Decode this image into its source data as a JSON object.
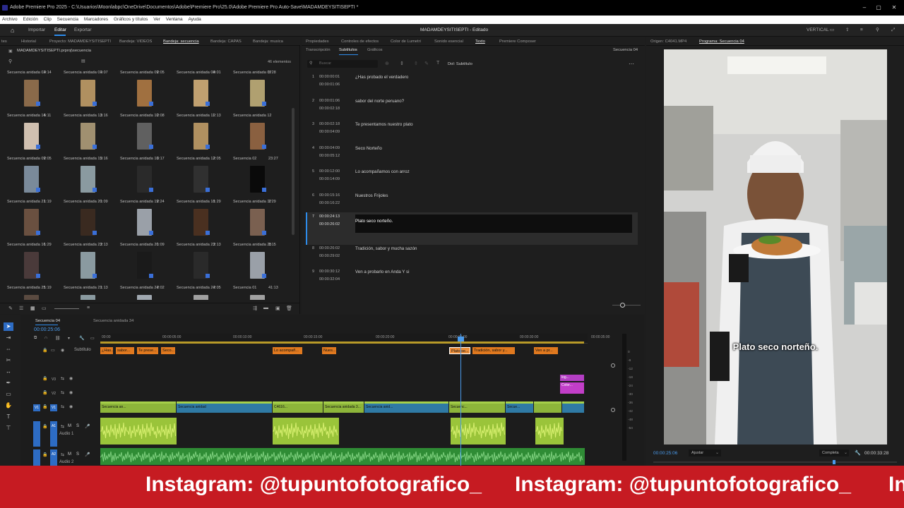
{
  "window": {
    "title": "Adobe Premiere Pro 2025 - C:\\Usuarios\\Moonlabpc\\OneDrive\\Documentos\\Adobe\\Premiere Pro\\25.0\\Adobe Premiere Pro Auto-Save\\MADAMDEYSITISEPTI *",
    "min": "–",
    "max": "▢",
    "close": "✕"
  },
  "menu": [
    "Archivo",
    "Edición",
    "Clip",
    "Secuencia",
    "Marcadores",
    "Gráficos y títulos",
    "Ver",
    "Ventana",
    "Ayuda"
  ],
  "workspace": {
    "home": "⌂",
    "import": "Importar",
    "edit": "Editar",
    "export": "Exportar",
    "project_title": "MADAMDEYSITISEPTI - Editado",
    "mode": "VERTICAL"
  },
  "project_panel": {
    "tabs": [
      "tes",
      "Historial",
      "Proyecto: MADAMDEYSITISEPTI",
      "Bandeja: VIDEOS",
      "Bandeja: secuencia",
      "Bandeja: CAPAS",
      "Bandeja: musica"
    ],
    "path": "MADAMDEYSITISEPTI.prproj\\secuencia",
    "count": "46 elementos",
    "items": [
      {
        "name": "Secuencia anidada 02",
        "dur": "4:14",
        "color": "#8a6a4a"
      },
      {
        "name": "Secuencia anidada 01",
        "dur": "4:07",
        "color": "#b09060"
      },
      {
        "name": "Secuencia anidada 09",
        "dur": "2:05",
        "color": "#a07040"
      },
      {
        "name": "Secuencia anidada 08",
        "dur": "4:01",
        "color": "#c0a070"
      },
      {
        "name": "Secuencia anidada 07",
        "dur": "5:28",
        "color": "#b0a070"
      },
      {
        "name": "Secuencia anidada 14",
        "dur": "5:11",
        "color": "#d0c0b0"
      },
      {
        "name": "Secuencia anidada 13",
        "dur": "3:16",
        "color": "#a09070"
      },
      {
        "name": "Secuencia anidada 10",
        "dur": "2:08",
        "color": "#606060"
      },
      {
        "name": "Secuencia anidada 11",
        "dur": "2:13",
        "color": "#b09060"
      },
      {
        "name": "Secuencia anidada 12",
        "dur": "",
        "color": "#8a6040"
      },
      {
        "name": "Secuencia anidada 09",
        "dur": "2:05",
        "color": "#7a8a9a"
      },
      {
        "name": "Secuencia anidada 15",
        "dur": "3:16",
        "color": "#8a9aa0"
      },
      {
        "name": "Secuencia anidada 16",
        "dur": "3:17",
        "color": "#2a2a2a"
      },
      {
        "name": "Secuencia anidada 12",
        "dur": "2:05",
        "color": "#303030"
      },
      {
        "name": "Secuencia 02",
        "dur": "23:27",
        "color": "#0a0a0a"
      },
      {
        "name": "Secuencia anidada 21",
        "dur": "1:19",
        "color": "#6a5040"
      },
      {
        "name": "Secuencia anidada 20",
        "dur": "1:09",
        "color": "#3a2a20"
      },
      {
        "name": "Secuencia anidada 19",
        "dur": "2:24",
        "color": "#9aa0a8"
      },
      {
        "name": "Secuencia anidada 18",
        "dur": "1:29",
        "color": "#4a3020"
      },
      {
        "name": "Secuencia anidada 17",
        "dur": "1:29",
        "color": "#7a6050"
      },
      {
        "name": "Secuencia anidada 16",
        "dur": "1:29",
        "color": "#4a3a3a"
      },
      {
        "name": "Secuencia anidada 23",
        "dur": "2:13",
        "color": "#8a9aa0"
      },
      {
        "name": "Secuencia anidada 20",
        "dur": "1:09",
        "color": "#1a1a1a"
      },
      {
        "name": "Secuencia anidada 23",
        "dur": "2:13",
        "color": "#2a2a2a"
      },
      {
        "name": "Secuencia anidada 25",
        "dur": "1:15",
        "color": "#9aa0a8"
      },
      {
        "name": "Secuencia anidada 25",
        "dur": "1:19",
        "color": "#5a4a40"
      },
      {
        "name": "Secuencia anidada 21",
        "dur": "1:13",
        "color": "#8a9aa0"
      },
      {
        "name": "Secuencia anidada 24",
        "dur": "2:02",
        "color": "#a0a8b0"
      },
      {
        "name": "Secuencia anidada 24",
        "dur": "2:05",
        "color": "#a0a0a0"
      },
      {
        "name": "Secuencia 01",
        "dur": "41:13",
        "color": "#a0a0a0"
      }
    ]
  },
  "text_panel": {
    "tabs": [
      "Propiedades",
      "Controles de efectos",
      "Color de Lumetri",
      "Sonido esencial",
      "Texto",
      "Premiere Composer"
    ],
    "subtabs": [
      "Transcripción",
      "Subtítulos",
      "Gráficos"
    ],
    "sequence": "Secuencia 04",
    "search_placeholder": "Buscar",
    "track": "Dol: Subtítulo",
    "captions": [
      {
        "n": "1",
        "in": "00:00:00:01",
        "out": "00:00:01:06",
        "text": "¿Has probado el verdadero"
      },
      {
        "n": "2",
        "in": "00:00:01:06",
        "out": "00:00:02:18",
        "text": "sabor del norte peruano?"
      },
      {
        "n": "3",
        "in": "00:00:02:18",
        "out": "00:00:04:09",
        "text": "Te presentamos nuestro plato"
      },
      {
        "n": "4",
        "in": "00:00:04:09",
        "out": "00:00:05:12",
        "text": "Seco Norteño"
      },
      {
        "n": "5",
        "in": "00:00:12:00",
        "out": "00:00:14:09",
        "text": "Lo acompañamos con arroz"
      },
      {
        "n": "6",
        "in": "00:00:15:16",
        "out": "00:00:16:22",
        "text": "Nuestros Frijoles"
      },
      {
        "n": "7",
        "in": "00:00:24:13",
        "out": "00:00:26:02",
        "text": "Plato seco norteño."
      },
      {
        "n": "8",
        "in": "00:00:26:02",
        "out": "00:00:29:02",
        "text": "Tradición, sabor y mucha sazón"
      },
      {
        "n": "9",
        "in": "00:00:30:12",
        "out": "00:00:32:04",
        "text": "Ven a probarlo en Anda Y si"
      }
    ]
  },
  "monitors": {
    "source": "Origen: C4041.MP4",
    "program": "Programa: Secuencia 04",
    "subtitle": "Plato seco norteño.",
    "timecode": "00:00:25:06",
    "fit": "Ajustar",
    "quality": "Completa",
    "duration": "00:00:33:28"
  },
  "timeline": {
    "tabs": [
      "Secuencia 04",
      "Secuencia anidada 34"
    ],
    "timecode": "00:00:25:06",
    "ruler": [
      "00:00",
      "00:00:05:00",
      "00:00:10:00",
      "00:00:15:00",
      "00:00:20:00",
      "00:00:25:00",
      "00:00:30:00",
      "00:00:35:00"
    ],
    "tracks": [
      "Subtítulo",
      "V3",
      "V2",
      "V1",
      "A1",
      "Audio 1",
      "A2",
      "Audio 2"
    ],
    "caption_clips": [
      "¿Has...",
      "sabor...",
      "Te prese...",
      "Seco...",
      "Lo acompañ...",
      "Nues...",
      "Plato se...",
      "Tradición, sabor y...",
      "Ven a pr..."
    ],
    "v1_clips": [
      "Secuencia an...",
      "Secuencia anidad",
      "C4616...",
      "Secuencia anidada 3...",
      "Secuencia anid...",
      "Secuenc...",
      "Secue..."
    ],
    "v3_clips": [
      "log...",
      "Color..."
    ],
    "meter": [
      "0",
      "-6",
      "-12",
      "-18",
      "-24",
      "-30",
      "-36",
      "-42",
      "-48",
      "-54"
    ]
  },
  "promo": {
    "text": "Instagram: @tupuntofotografico_",
    "text2": "Instagram: @tupuntofotografico_",
    "text3": "In"
  }
}
